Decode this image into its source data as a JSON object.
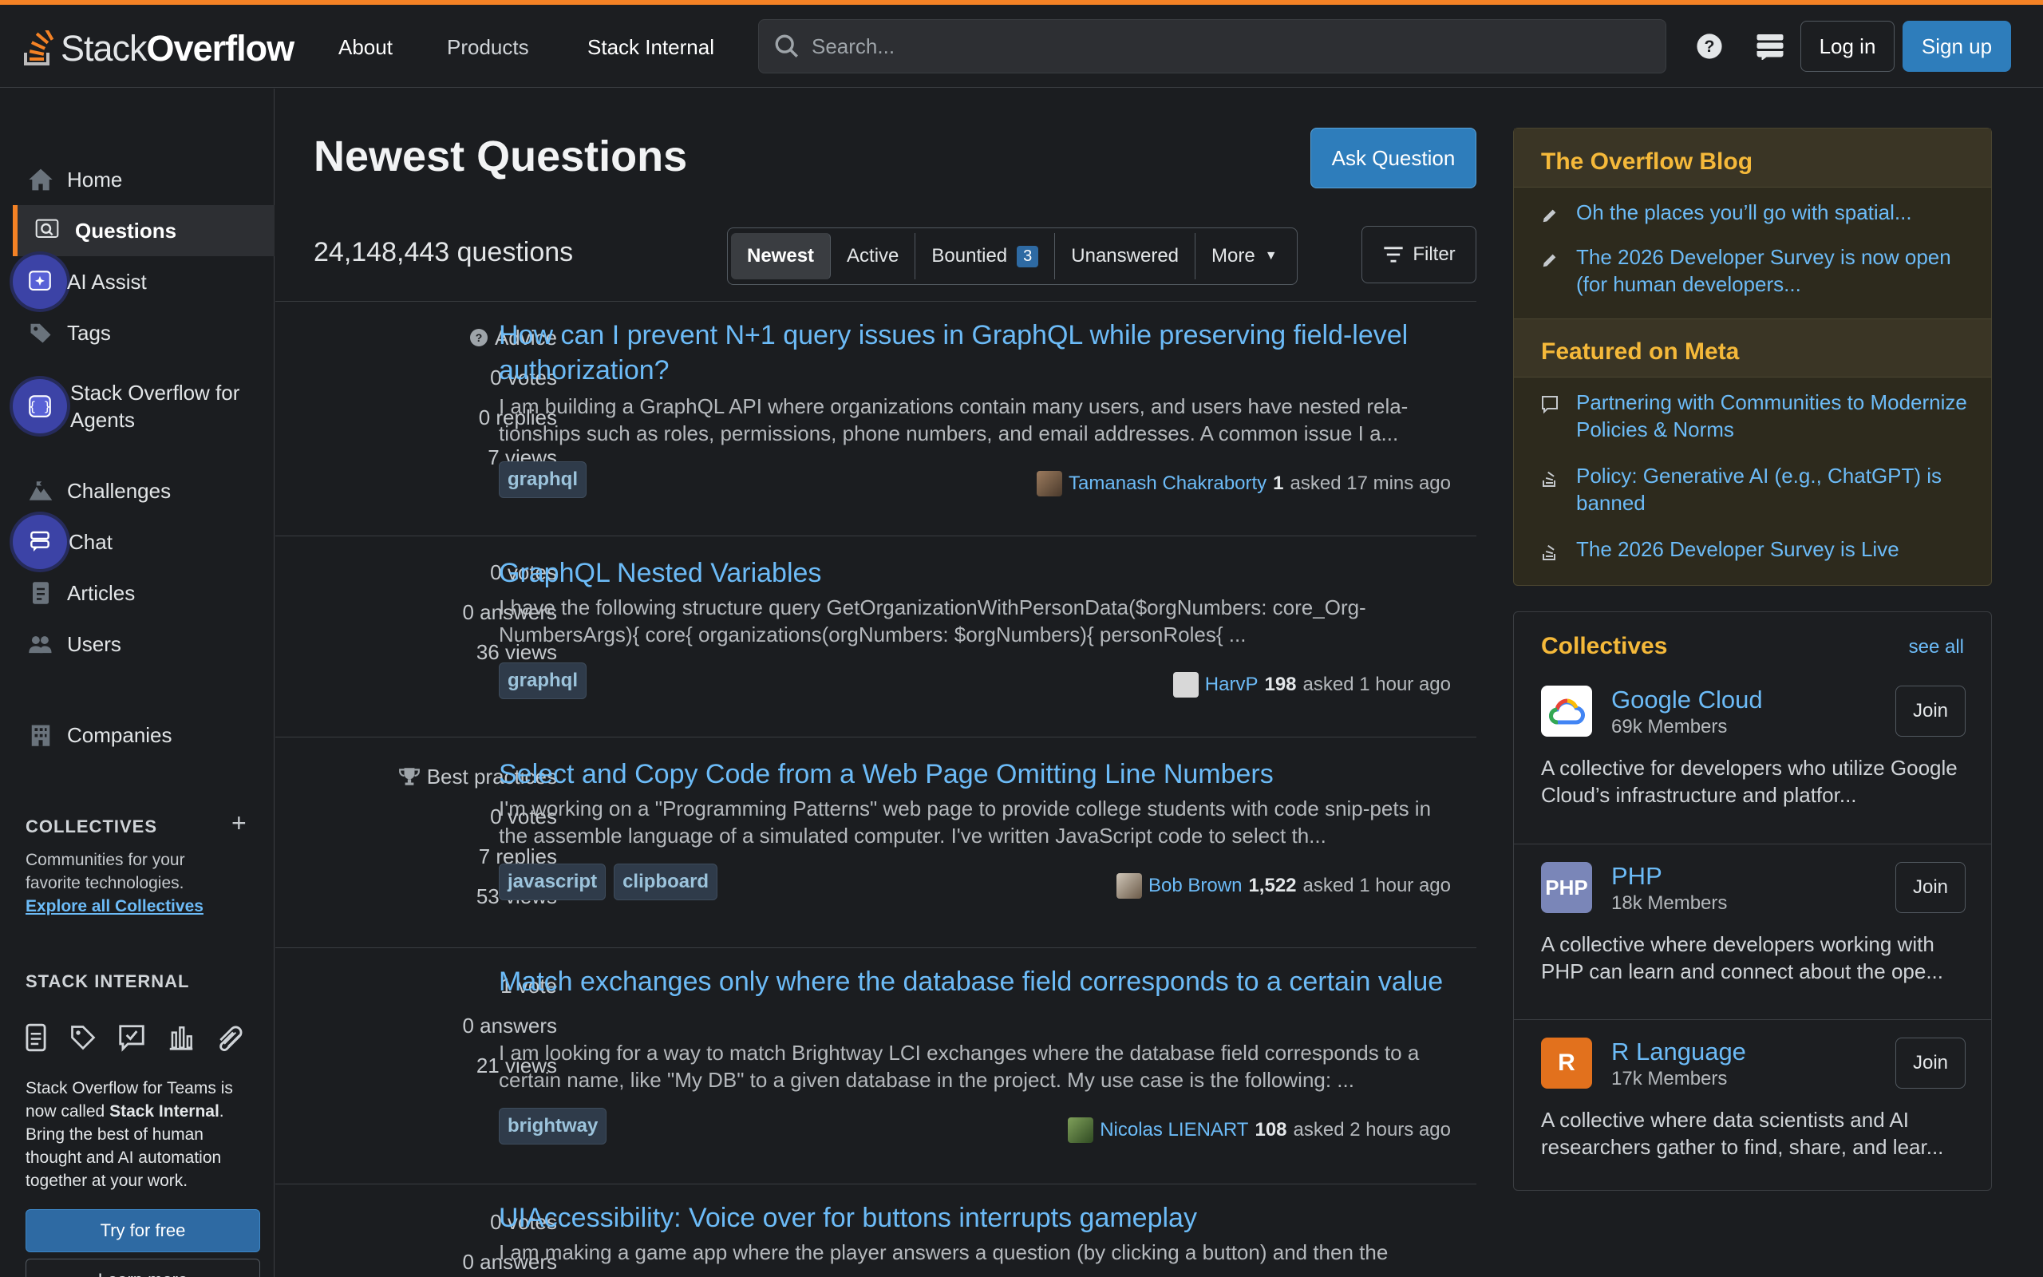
{
  "header": {
    "logo_bold": "Stack",
    "logo_light": "Overflow",
    "nav": [
      "About",
      "Products",
      "Stack Internal"
    ],
    "search_placeholder": "Search...",
    "login": "Log in",
    "signup": "Sign up",
    "accent": "#f48225"
  },
  "sidebar": {
    "items": [
      {
        "label": "Home",
        "icon": "home-icon"
      },
      {
        "label": "Questions",
        "icon": "questions-icon",
        "active": true
      },
      {
        "label": "AI Assist",
        "icon": "ai-assist-icon"
      },
      {
        "label": "Tags",
        "icon": "tag-icon"
      },
      {
        "label": "Stack Overflow for",
        "label2": "Agents",
        "icon": "agents-icon"
      },
      {
        "label": "Challenges",
        "icon": "challenges-icon"
      },
      {
        "label": "Chat",
        "icon": "chat-icon"
      },
      {
        "label": "Articles",
        "icon": "articles-icon"
      },
      {
        "label": "Users",
        "icon": "users-icon"
      },
      {
        "label": "Companies",
        "icon": "companies-icon"
      }
    ],
    "collectives_heading": "COLLECTIVES",
    "collectives_text1": "Communities for your",
    "collectives_text2": "favorite technologies.",
    "collectives_link": "Explore all Collectives",
    "internal_heading": "STACK INTERNAL",
    "internal_text_a": "Stack Overflow for Teams is",
    "internal_text_b": "now called ",
    "internal_text_bold": "Stack Internal",
    "internal_text_c": ".",
    "internal_text_d": "Bring the best of human",
    "internal_text_e": "thought and AI automation",
    "internal_text_f": "together at your work.",
    "try_label": "Try for free",
    "learn_label": "Learn more"
  },
  "main": {
    "title": "Newest Questions",
    "ask_label": "Ask Question",
    "count": "24,148,443 questions",
    "tabs": [
      {
        "label": "Newest"
      },
      {
        "label": "Active"
      },
      {
        "label": "Bountied",
        "badge": "3"
      },
      {
        "label": "Unanswered"
      },
      {
        "label": "More"
      }
    ],
    "filter_label": "Filter",
    "questions": [
      {
        "kind": "Advice",
        "stats": [
          "0 votes",
          "0 replies",
          "7 views"
        ],
        "title": "How can I prevent N+1 query issues in GraphQL while preserving field-level authorization?",
        "excerpt": "I am building a GraphQL API where organizations contain many users, and users have nested rela-tionships such as roles, permissions, phone numbers, and email addresses. A common issue I a...",
        "tags": [
          "graphql"
        ],
        "user": "Tamanash Chakraborty",
        "rep": "1",
        "time": "asked 17 mins ago"
      },
      {
        "kind": "",
        "stats": [
          "0 votes",
          "0 answers",
          "36 views"
        ],
        "title": "GraphQL Nested Variables",
        "excerpt": "I have the following structure query GetOrganizationWithPersonData($orgNumbers: core_Org-NumbersArgs){ core{ organizations(orgNumbers: $orgNumbers){ personRoles{ ...",
        "tags": [
          "graphql"
        ],
        "user": "HarvP",
        "rep": "198",
        "time": "asked 1 hour ago"
      },
      {
        "kind": "Best practices",
        "stats": [
          "0 votes",
          "7 replies",
          "53 views"
        ],
        "title": "Select and Copy Code from a Web Page Omitting Line Numbers",
        "excerpt": "I'm working on a \"Programming Patterns\" web page to provide college students with code snip-pets in the assemble language of a simulated computer. I've written JavaScript code to select th...",
        "tags": [
          "javascript",
          "clipboard"
        ],
        "user": "Bob Brown",
        "rep": "1,522",
        "time": "asked 1 hour ago"
      },
      {
        "kind": "",
        "stats": [
          "1 vote",
          "0 answers",
          "21 views"
        ],
        "title": "Match exchanges only where the database field corresponds to a certain value",
        "excerpt": "I am looking for a way to match Brightway LCI exchanges where the database field corresponds to a certain name, like \"My DB\" to a given database in the project. My use case is the following: ...",
        "tags": [
          "brightway"
        ],
        "user": "Nicolas LIENART",
        "rep": "108",
        "time": "asked 2 hours ago"
      },
      {
        "kind": "",
        "stats": [
          "0 votes",
          "0 answers",
          ""
        ],
        "title": "UIAccessibility: Voice over for buttons interrupts gameplay",
        "excerpt": "I am making a game app where the player answers a question (by clicking a button) and then the",
        "tags": [],
        "user": "",
        "rep": "",
        "time": ""
      }
    ]
  },
  "blog": {
    "heading": "The Overflow Blog",
    "items": [
      {
        "text": "Oh the places you’ll go with spatial...",
        "icon": "pencil-icon"
      },
      {
        "text": "The 2026 Developer Survey is now open (for human developers...",
        "icon": "pencil-icon"
      }
    ],
    "meta_heading": "Featured on Meta",
    "meta_items": [
      {
        "text": "Partnering with Communities to Modernize Policies & Norms",
        "icon": "chat-bubble-icon"
      },
      {
        "text": "Policy: Generative AI (e.g., ChatGPT) is banned",
        "icon": "stack-logo-icon"
      },
      {
        "text": "The 2026 Developer Survey is Live",
        "icon": "stack-logo-icon"
      }
    ]
  },
  "collectives": {
    "heading": "Collectives",
    "see_all": "see all",
    "items": [
      {
        "name": "Google Cloud",
        "members": "69k Members",
        "desc": "A collective for developers who utilize Google Cloud’s infrastructure and platfor...",
        "join": "Join",
        "logo": "",
        "color": "#ffffff"
      },
      {
        "name": "PHP",
        "members": "18k Members",
        "desc": "A collective where developers working with PHP can learn and connect about the ope...",
        "join": "Join",
        "logo": "PHP",
        "color": "#7a86b8"
      },
      {
        "name": "R Language",
        "members": "17k Members",
        "desc": "A collective where data scientists and AI researchers gather to find, share, and lear...",
        "join": "Join",
        "logo": "R",
        "color": "#e2711d"
      }
    ]
  }
}
